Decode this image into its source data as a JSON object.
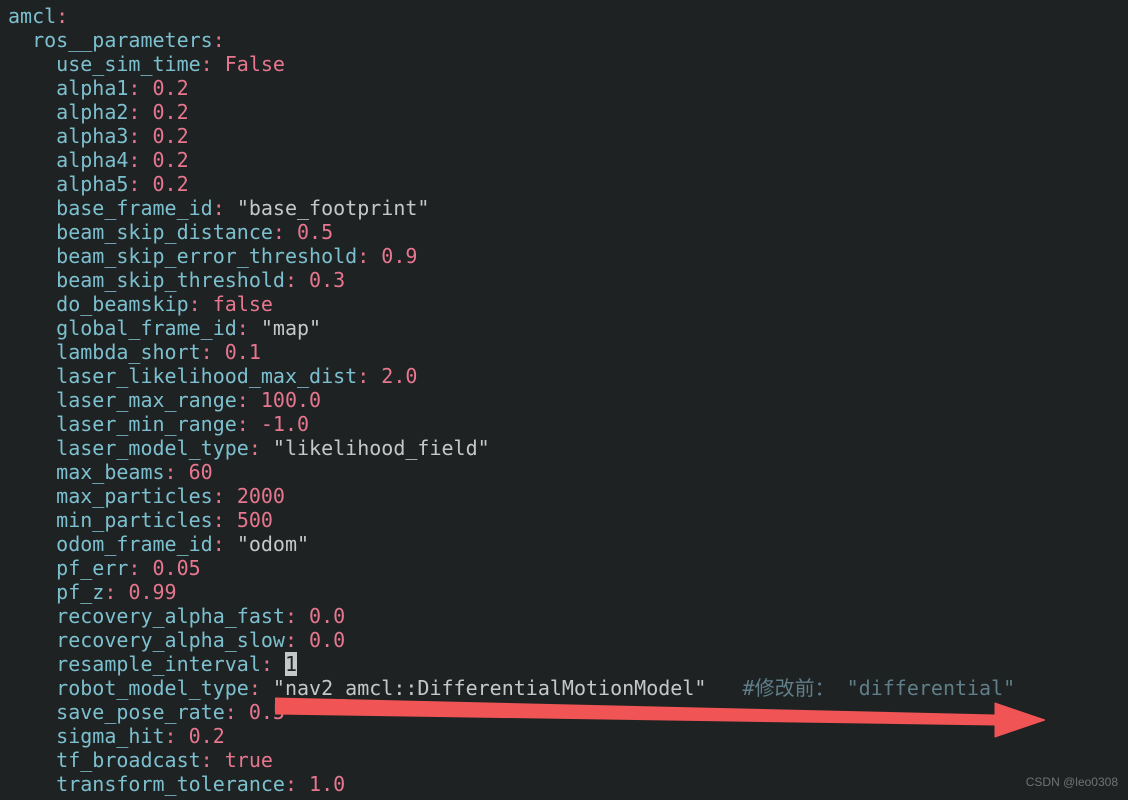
{
  "watermark": "CSDN @leo0308",
  "yaml": {
    "root_key": "amcl",
    "section_key": "ros__parameters",
    "params": [
      {
        "key": "use_sim_time",
        "type": "kw",
        "value": "False"
      },
      {
        "key": "alpha1",
        "type": "num",
        "value": "0.2"
      },
      {
        "key": "alpha2",
        "type": "num",
        "value": "0.2"
      },
      {
        "key": "alpha3",
        "type": "num",
        "value": "0.2"
      },
      {
        "key": "alpha4",
        "type": "num",
        "value": "0.2"
      },
      {
        "key": "alpha5",
        "type": "num",
        "value": "0.2"
      },
      {
        "key": "base_frame_id",
        "type": "str",
        "value": "\"base_footprint\""
      },
      {
        "key": "beam_skip_distance",
        "type": "num",
        "value": "0.5"
      },
      {
        "key": "beam_skip_error_threshold",
        "type": "num",
        "value": "0.9"
      },
      {
        "key": "beam_skip_threshold",
        "type": "num",
        "value": "0.3"
      },
      {
        "key": "do_beamskip",
        "type": "kw",
        "value": "false"
      },
      {
        "key": "global_frame_id",
        "type": "str",
        "value": "\"map\""
      },
      {
        "key": "lambda_short",
        "type": "num",
        "value": "0.1"
      },
      {
        "key": "laser_likelihood_max_dist",
        "type": "num",
        "value": "2.0"
      },
      {
        "key": "laser_max_range",
        "type": "num",
        "value": "100.0"
      },
      {
        "key": "laser_min_range",
        "type": "num",
        "value": "-1.0"
      },
      {
        "key": "laser_model_type",
        "type": "str",
        "value": "\"likelihood_field\""
      },
      {
        "key": "max_beams",
        "type": "num",
        "value": "60"
      },
      {
        "key": "max_particles",
        "type": "num",
        "value": "2000"
      },
      {
        "key": "min_particles",
        "type": "num",
        "value": "500"
      },
      {
        "key": "odom_frame_id",
        "type": "str",
        "value": "\"odom\""
      },
      {
        "key": "pf_err",
        "type": "num",
        "value": "0.05"
      },
      {
        "key": "pf_z",
        "type": "num",
        "value": "0.99"
      },
      {
        "key": "recovery_alpha_fast",
        "type": "num",
        "value": "0.0"
      },
      {
        "key": "recovery_alpha_slow",
        "type": "num",
        "value": "0.0"
      },
      {
        "key": "resample_interval",
        "type": "cursor",
        "value": "1"
      },
      {
        "key": "robot_model_type",
        "type": "str",
        "value": "\"nav2_amcl::DifferentialMotionModel\"",
        "trail_comment": "   #修改前： \"differential\""
      },
      {
        "key": "save_pose_rate",
        "type": "num",
        "value": "0.5"
      },
      {
        "key": "sigma_hit",
        "type": "num",
        "value": "0.2"
      },
      {
        "key": "tf_broadcast",
        "type": "kw",
        "value": "true"
      },
      {
        "key": "transform_tolerance",
        "type": "num",
        "value": "1.0"
      }
    ]
  }
}
